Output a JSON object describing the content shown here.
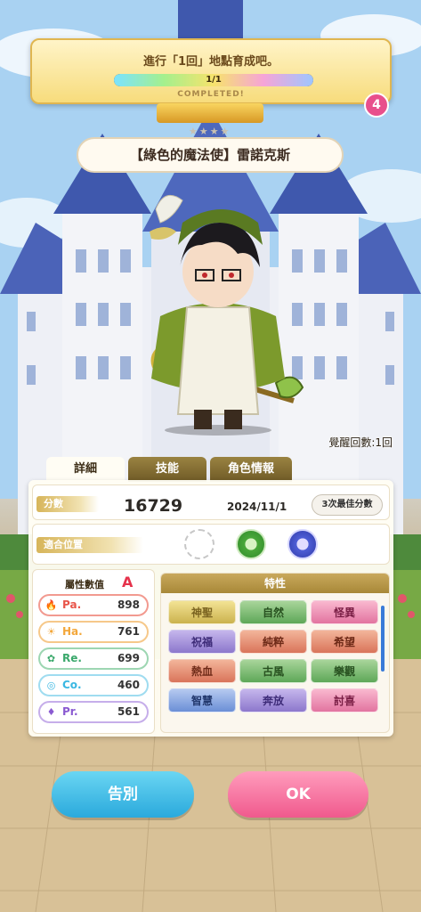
{
  "mission": {
    "text": "進行「1回」地點育成吧。",
    "progress_label": "1/1",
    "progress": 1.0,
    "status": "COMPLETED!",
    "badge": "4"
  },
  "result": {
    "stars": "★★★★",
    "character_name": "【綠色的魔法使】雷諾克斯",
    "awaken_label": "覺醒回數:1回"
  },
  "tabs": [
    {
      "label": "詳細"
    },
    {
      "label": "技能"
    },
    {
      "label": "角色情報"
    }
  ],
  "detail": {
    "score_label": "分數",
    "score": "16729",
    "date": "2024/11/1",
    "best_button": "3次最佳分數",
    "position_label": "適合位置"
  },
  "stats": {
    "title": "屬性數值",
    "rank": "A",
    "items": [
      {
        "name": "Pa.",
        "value": "898",
        "color": "#e8554a",
        "icon": "flame-icon"
      },
      {
        "name": "Ha.",
        "value": "761",
        "color": "#f3a73a",
        "icon": "sun-icon"
      },
      {
        "name": "Re.",
        "value": "699",
        "color": "#3aa86b",
        "icon": "clover-icon"
      },
      {
        "name": "Co.",
        "value": "460",
        "color": "#3ab7e2",
        "icon": "bubble-icon"
      },
      {
        "name": "Pr.",
        "value": "561",
        "color": "#8a5ad1",
        "icon": "gem-icon"
      }
    ]
  },
  "traits": {
    "title": "特性",
    "items": [
      {
        "label": "神聖",
        "color": "yellow"
      },
      {
        "label": "自然",
        "color": "green"
      },
      {
        "label": "怪異",
        "color": "pink"
      },
      {
        "label": "祝福",
        "color": "purple"
      },
      {
        "label": "純粹",
        "color": "red"
      },
      {
        "label": "希望",
        "color": "red"
      },
      {
        "label": "熱血",
        "color": "red"
      },
      {
        "label": "古風",
        "color": "green"
      },
      {
        "label": "樂觀",
        "color": "green"
      },
      {
        "label": "智慧",
        "color": "blue"
      },
      {
        "label": "奔放",
        "color": "purple"
      },
      {
        "label": "討喜",
        "color": "pink"
      }
    ]
  },
  "buttons": {
    "farewell": "告別",
    "ok": "OK"
  }
}
